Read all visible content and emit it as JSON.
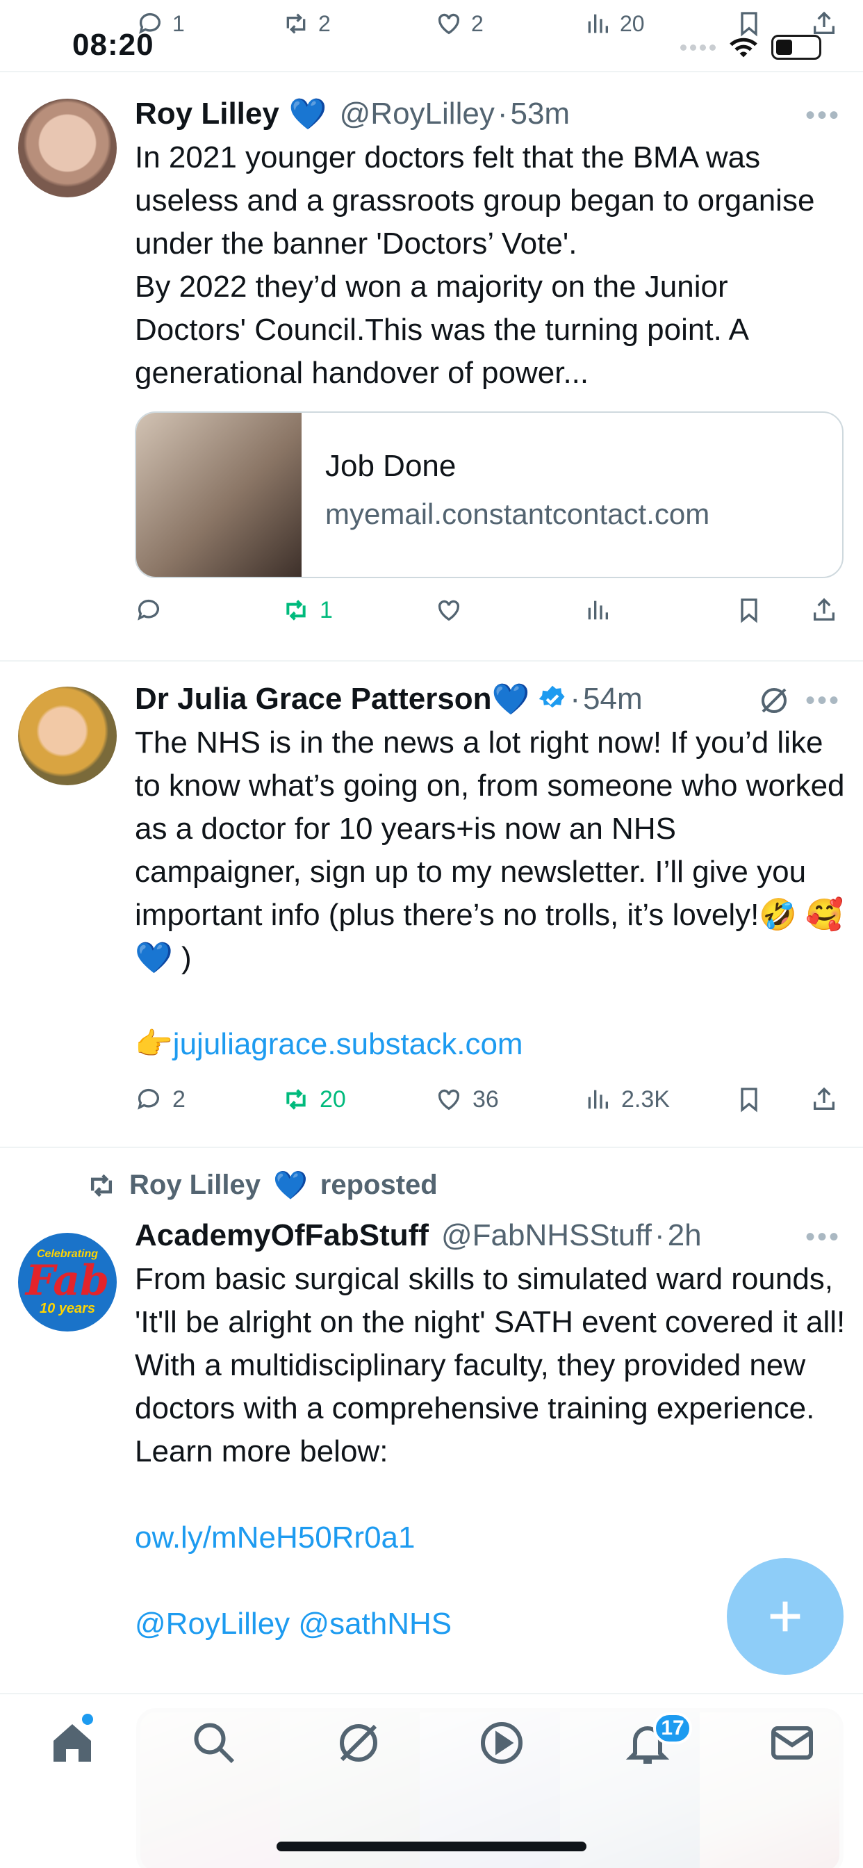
{
  "status_bar": {
    "time": "08:20"
  },
  "top_tweet_actions": {
    "replies": "1",
    "reposts": "2",
    "likes": "2",
    "views": "20"
  },
  "tweets": [
    {
      "name": "Roy Lilley",
      "name_emoji": "💙",
      "handle": "@RoyLilley",
      "time": "53m",
      "text": "In 2021 younger doctors felt that the BMA was useless and a grassroots group began to organise under the banner 'Doctors’ Vote'.\nBy 2022 they’d won a majority on the Junior Doctors' Council.This was the turning point. A generational handover of power...",
      "card": {
        "title": "Job Done",
        "domain": "myemail.constantcontact.com"
      },
      "reposts": "1"
    },
    {
      "name": "Dr Julia Grace Patterson",
      "name_emoji": "💙",
      "time": "54m",
      "text": "The NHS is in the news a lot right now! If you’d like to know what’s going on, from someone who worked as a doctor for 10 years+is now an NHS campaigner, sign up to my newsletter. I’ll give you important info (plus there’s no trolls, it’s lovely!🤣 🥰 💙 )",
      "link_prefix": "👉",
      "link": "jujuliagrace.substack.com",
      "replies": "2",
      "reposts": "20",
      "likes": "36",
      "views": "2.3K"
    },
    {
      "repost_by": "Roy Lilley",
      "repost_emoji": "💙",
      "repost_label": "reposted",
      "name": "AcademyOfFabStuff",
      "handle": "@FabNHSStuff",
      "time": "2h",
      "avatar_top": "Celebrating",
      "avatar_mid": "Fab",
      "avatar_bottom": "10 years",
      "text": "From basic surgical skills to simulated ward rounds, 'It'll be alright on the night' SATH event covered it all! With a multidisciplinary faculty, they provided new doctors with a comprehensive training experience. Learn more below:",
      "link": "ow.ly/mNeH50Rr0a1",
      "mentions": "@RoyLilley @sathNHS"
    }
  ],
  "bottom_nav": {
    "notifications_badge": "17"
  },
  "colors": {
    "accent": "#1d9bf0",
    "repost_green": "#00ba7c",
    "muted": "#536471"
  },
  "icons": [
    "reply-icon",
    "repost-icon",
    "like-icon",
    "views-icon",
    "bookmark-icon",
    "share-icon",
    "verified-icon",
    "grok-icon",
    "home-icon",
    "search-icon",
    "play-icon",
    "bell-icon",
    "mail-icon",
    "plus-icon"
  ]
}
